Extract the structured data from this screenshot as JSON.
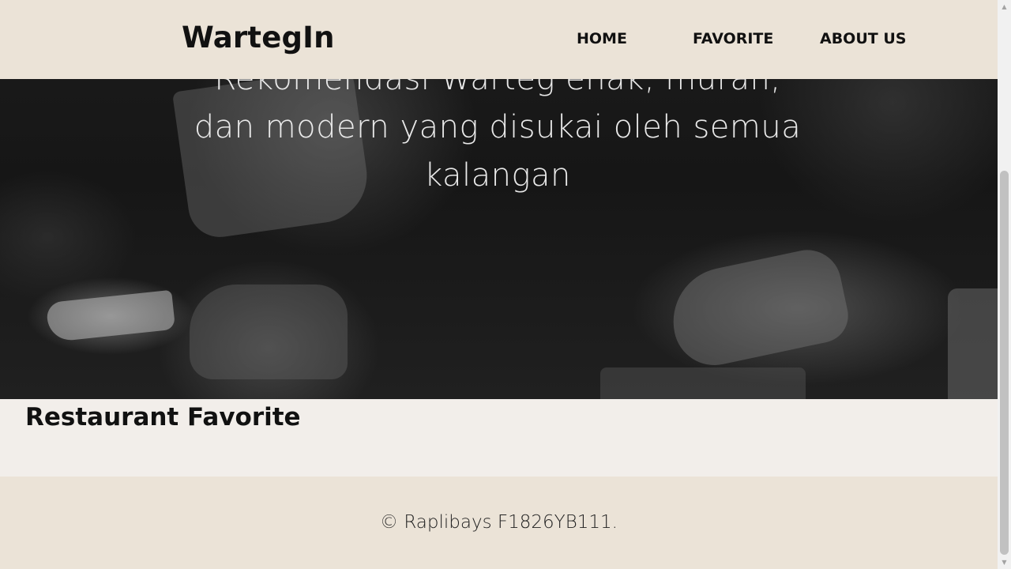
{
  "header": {
    "logo": "WartegIn",
    "nav": [
      {
        "label": "HOME"
      },
      {
        "label": "FAVORITE"
      },
      {
        "label": "ABOUT US"
      }
    ]
  },
  "hero": {
    "title": "Rekomendasi Warteg enak, murah, dan modern yang disukai oleh semua kalangan"
  },
  "favorite": {
    "title": "Restaurant Favorite"
  },
  "footer": {
    "text": "© Raplibays F1826YB111."
  },
  "scrollbar": {
    "up_icon": "arrow-up-icon",
    "down_icon": "arrow-down-icon"
  },
  "colors": {
    "header_bg": "#ebe3d7",
    "section_bg": "#f2eeea",
    "text": "#111111",
    "hero_text": "#e9e9e9"
  }
}
